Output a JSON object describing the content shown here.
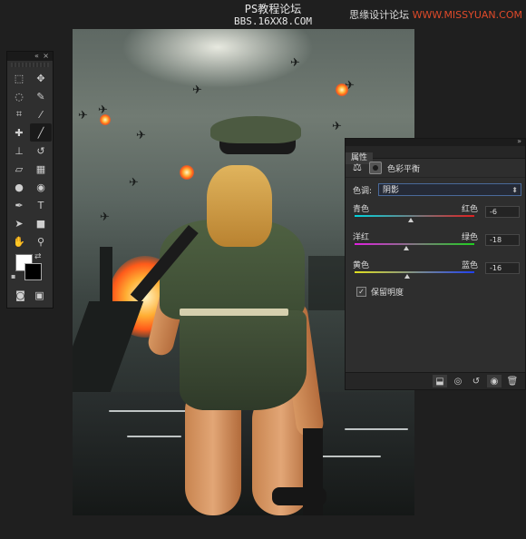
{
  "watermark": {
    "line1": "PS教程论坛",
    "line2": "BBS.16XX8.COM",
    "right_prefix": "思缘设计论坛",
    "right_url": "WWW.MISSYUAN.COM"
  },
  "tools": {
    "items": [
      "marquee",
      "move",
      "lasso",
      "quick-select",
      "crop",
      "eyedropper",
      "healing",
      "brush",
      "stamp",
      "history-brush",
      "eraser",
      "gradient",
      "blur",
      "dodge",
      "pen",
      "type",
      "path-select",
      "shape",
      "hand",
      "zoom"
    ],
    "type_glyph": "T",
    "foreground": "#ffffff",
    "background": "#000000"
  },
  "properties": {
    "tab": "属性",
    "title": "色彩平衡",
    "tone_label": "色调:",
    "tone_value": "阴影",
    "sliders": [
      {
        "left": "青色",
        "right": "红色",
        "value": "-6",
        "fraction": 0.47,
        "colors": [
          "#00d6e0",
          "#e02020"
        ]
      },
      {
        "left": "洋红",
        "right": "绿色",
        "value": "-18",
        "fraction": 0.43,
        "colors": [
          "#e020e0",
          "#20d020"
        ]
      },
      {
        "left": "黄色",
        "right": "蓝色",
        "value": "-16",
        "fraction": 0.44,
        "colors": [
          "#e0e020",
          "#2040f0"
        ]
      }
    ],
    "preserve_luminosity": "保留明度",
    "preserve_checked": true
  }
}
